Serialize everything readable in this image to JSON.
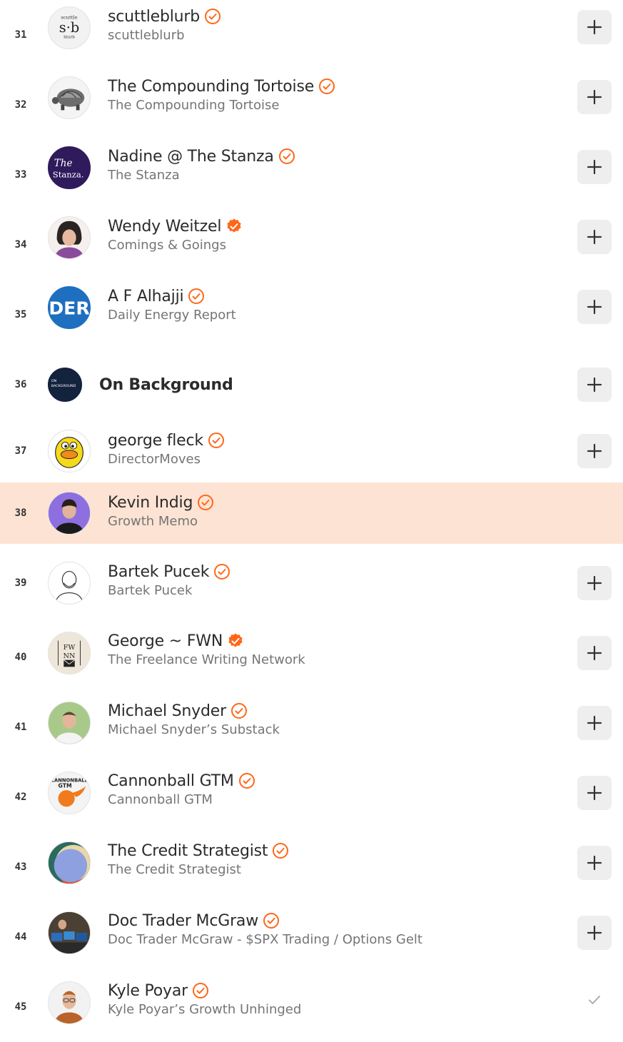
{
  "accent": "#ff6719",
  "highlight_color": "#fde3d3",
  "rows": [
    {
      "rank": "31",
      "name": "scuttleblurb",
      "sub": "scuttleblurb",
      "badge": "outline",
      "action": "add",
      "avatar_text": [
        "scuttle",
        "s·b",
        "blurb"
      ]
    },
    {
      "rank": "32",
      "name": "The Compounding Tortoise",
      "sub": "The Compounding Tortoise",
      "badge": "outline",
      "action": "add"
    },
    {
      "rank": "33",
      "name": "Nadine @ The Stanza",
      "sub": "The Stanza",
      "badge": "outline",
      "action": "add",
      "avatar_text": [
        "The",
        "Stanza."
      ]
    },
    {
      "rank": "34",
      "name": "Wendy Weitzel",
      "sub": "Comings & Goings",
      "badge": "filled",
      "action": "add"
    },
    {
      "rank": "35",
      "name": "A F Alhajji",
      "sub": "Daily Energy Report",
      "badge": "outline",
      "action": "add",
      "avatar_text": [
        "DER"
      ]
    },
    {
      "rank": "36",
      "name": "On Background",
      "sub": "",
      "badge": "none",
      "action": "add",
      "avatar_text": [
        "ON",
        "BACKGROUND"
      ]
    },
    {
      "rank": "37",
      "name": "george fleck",
      "sub": "DirectorMoves",
      "badge": "outline",
      "action": "add"
    },
    {
      "rank": "38",
      "name": "Kevin Indig",
      "sub": "Growth Memo",
      "badge": "outline",
      "action": "none",
      "highlight": true
    },
    {
      "rank": "39",
      "name": "Bartek Pucek",
      "sub": "Bartek Pucek",
      "badge": "outline",
      "action": "add"
    },
    {
      "rank": "40",
      "name": "George ~ FWN",
      "sub": "The Freelance Writing Network",
      "badge": "filled",
      "action": "add",
      "avatar_text": [
        "FW",
        "NN"
      ]
    },
    {
      "rank": "41",
      "name": "Michael Snyder",
      "sub": "Michael Snyder’s Substack",
      "badge": "outline",
      "action": "add"
    },
    {
      "rank": "42",
      "name": "Cannonball GTM",
      "sub": "Cannonball GTM",
      "badge": "outline",
      "action": "add",
      "avatar_text": [
        "CANNONBALL",
        "GTM"
      ]
    },
    {
      "rank": "43",
      "name": "The Credit Strategist",
      "sub": "The Credit Strategist",
      "badge": "outline",
      "action": "add"
    },
    {
      "rank": "44",
      "name": "Doc Trader McGraw",
      "sub": "Doc Trader McGraw - $SPX Trading / Options Gelt",
      "badge": "outline",
      "action": "add"
    },
    {
      "rank": "45",
      "name": "Kyle Poyar",
      "sub": "Kyle Poyar’s Growth Unhinged",
      "badge": "outline",
      "action": "subscribed"
    }
  ]
}
